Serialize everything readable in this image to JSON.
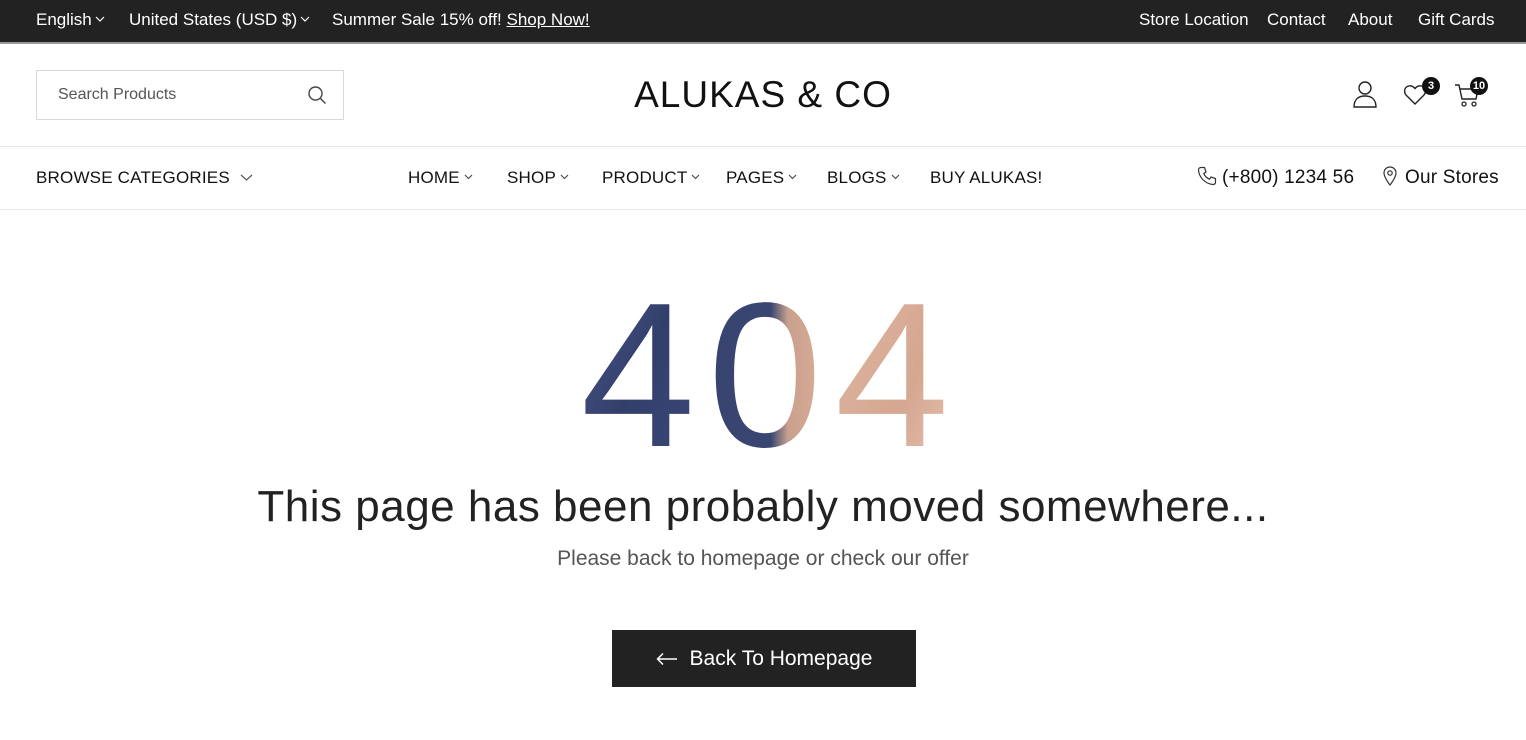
{
  "topbar": {
    "language": "English",
    "currency": "United States (USD $)",
    "promo_text": "Summer Sale 15% off! ",
    "promo_link": "Shop Now!",
    "links": [
      "Store Location",
      "Contact",
      "About",
      "Gift Cards"
    ]
  },
  "header": {
    "search_placeholder": "Search Products",
    "logo": "ALUKAS & CO",
    "wishlist_count": "3",
    "cart_count": "10"
  },
  "nav": {
    "browse": "BROWSE CATEGORIES",
    "items": [
      "HOME",
      "SHOP",
      "PRODUCT",
      "PAGES",
      "BLOGS",
      "BUY ALUKAS!"
    ],
    "phone": "(+800) 1234 56",
    "stores": "Our Stores"
  },
  "main": {
    "error_code": "404",
    "headline": "This page has been probably moved somewhere...",
    "subline": "Please back to homepage or check our offer",
    "button": "Back To Homepage"
  },
  "colors": {
    "topbar_bg": "#222222",
    "navy": "#3d4a7a",
    "rose": "#d8ab96",
    "button_bg": "#222222"
  }
}
